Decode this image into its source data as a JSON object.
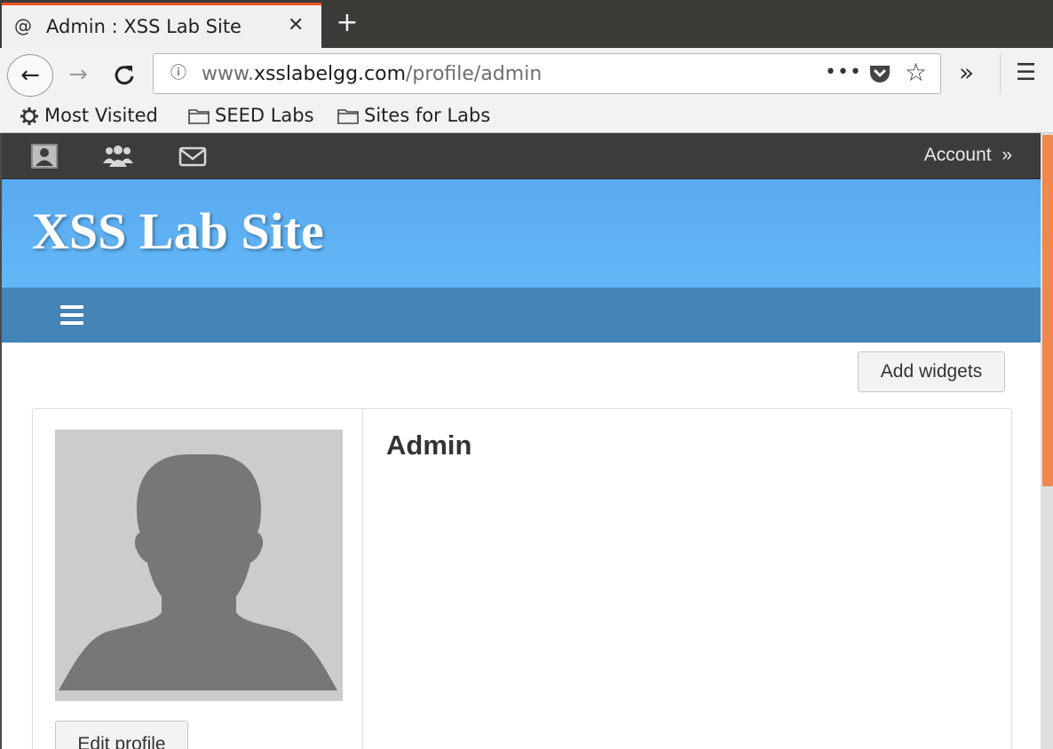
{
  "browser": {
    "tab": {
      "title": "Admin : XSS Lab Site",
      "close_glyph": "✕",
      "favicon": "at-sign-icon"
    },
    "new_tab_glyph": "+",
    "toolbar": {
      "back_glyph": "←",
      "forward_glyph": "→",
      "reload_glyph": "C",
      "info_glyph": "ⓘ",
      "more_glyph": "•••",
      "star_glyph": "☆",
      "overflow_glyph": "»",
      "menu_glyph": "☰"
    },
    "url": {
      "prefix": "www.",
      "host": "xsslabelgg.com",
      "path": "/profile/admin"
    },
    "bookmarks": [
      {
        "label": "Most Visited",
        "icon": "gear-icon"
      },
      {
        "label": "SEED Labs",
        "icon": "folder-icon"
      },
      {
        "label": "Sites for Labs",
        "icon": "folder-icon"
      }
    ]
  },
  "site": {
    "topbar": {
      "icons": [
        "profile-icon",
        "friends-icon",
        "messages-icon"
      ],
      "account_label": "Account",
      "account_glyph": "»"
    },
    "title": "XSS Lab Site",
    "menu_icon": "hamburger-icon",
    "add_widgets_label": "Add widgets",
    "profile": {
      "name": "Admin",
      "edit_label": "Edit profile"
    }
  },
  "colors": {
    "tab_accent": "#e95420",
    "topbar_bg": "#3c3c3c",
    "banner_bg": "#5cb0f2",
    "menubar_bg": "#4584b6",
    "scrollbar_thumb": "#f0874d",
    "avatar_bg": "#cccccc",
    "avatar_silhouette": "#777777"
  }
}
